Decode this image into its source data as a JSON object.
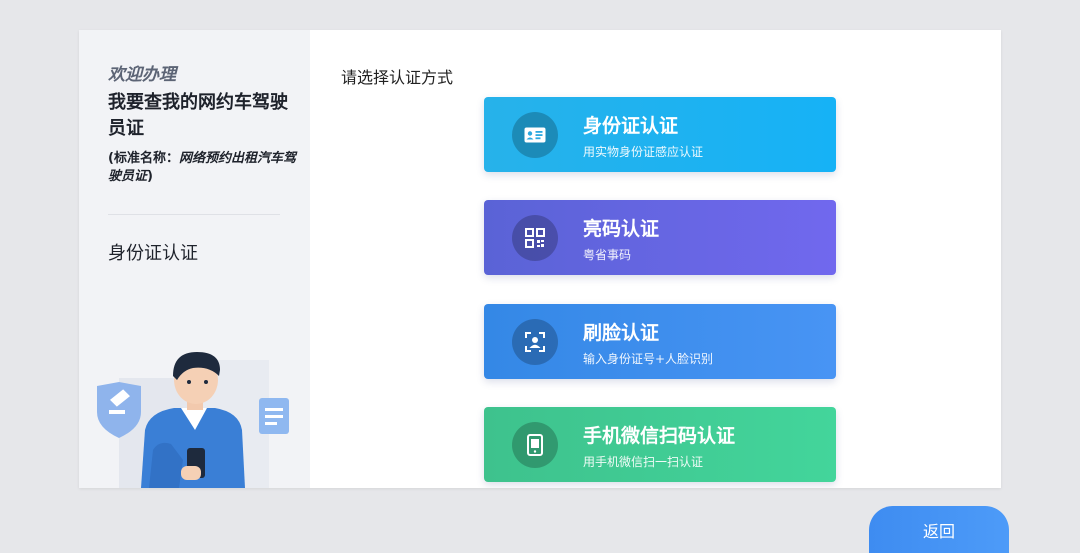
{
  "sidebar": {
    "welcome": "欢迎办理",
    "service_title": "我要查我的网约车驾驶员证",
    "standard_name_prefix": "(标准名称：",
    "standard_name_value": "网络预约出租汽车驾驶员证",
    "standard_name_suffix": ")",
    "current_step": "身份证认证"
  },
  "main": {
    "prompt": "请选择认证方式",
    "options": [
      {
        "title": "身份证认证",
        "subtitle": "用实物身份证感应认证",
        "icon": "id-card-icon",
        "color": "#1fb2f0"
      },
      {
        "title": "亮码认证",
        "subtitle": "粤省事码",
        "icon": "qr-code-icon",
        "color": "#6566e2"
      },
      {
        "title": "刷脸认证",
        "subtitle": "输入身份证号+人脸识别",
        "icon": "face-scan-icon",
        "color": "#3e8eed"
      },
      {
        "title": "手机微信扫码认证",
        "subtitle": "用手机微信扫一扫认证",
        "icon": "mobile-phone-icon",
        "color": "#40cc94"
      }
    ]
  },
  "footer": {
    "back_label": "返回"
  }
}
